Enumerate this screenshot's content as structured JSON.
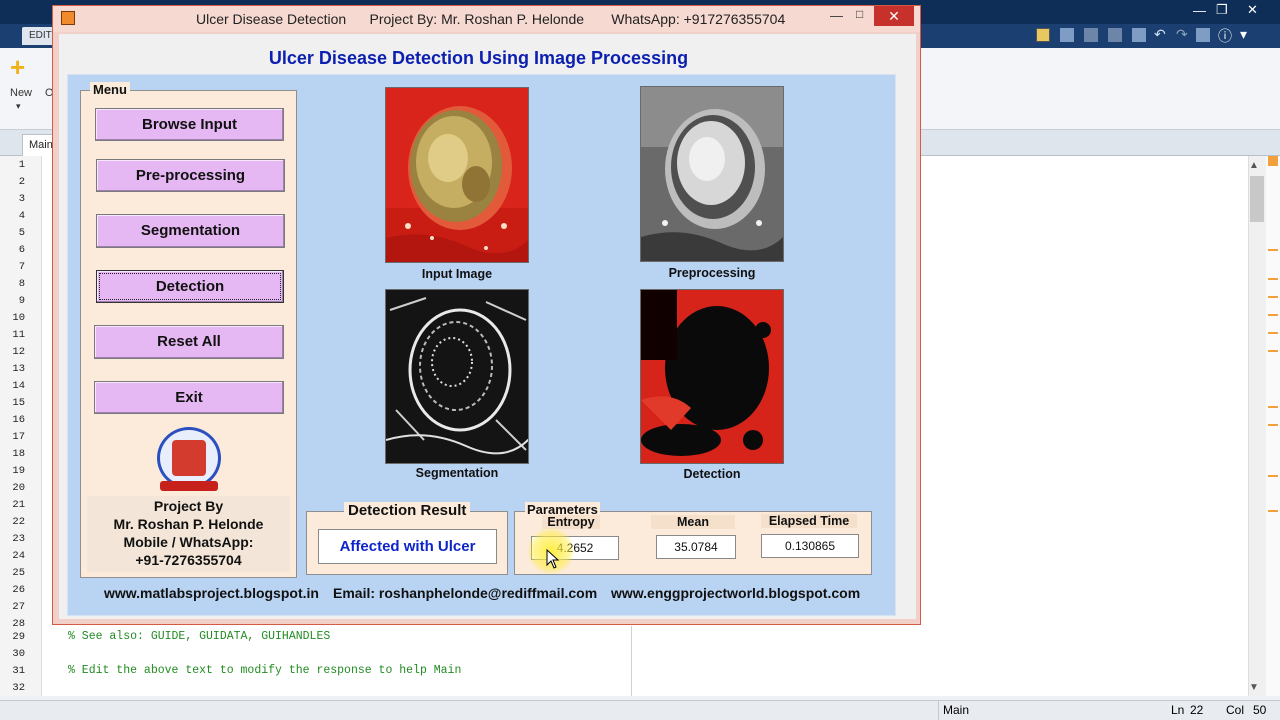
{
  "ide": {
    "editor_tab": "EDITO",
    "ribbon": {
      "new_label": "New",
      "open_label": "O"
    },
    "doc_tab": "Main",
    "line_numbers": [
      "1",
      "2",
      "3",
      "4",
      "5",
      "6",
      "7",
      "8",
      "9",
      "10",
      "11",
      "12",
      "13",
      "14",
      "15",
      "16",
      "17",
      "18",
      "19",
      "20",
      "21",
      "22",
      "23",
      "24",
      "25",
      "26",
      "27",
      "28",
      "29",
      "30",
      "31",
      "32"
    ],
    "code": {
      "line29": "% See also: GUIDE, GUIDATA, GUIHANDLES",
      "line31": "% Edit the above text to modify the response to help Main"
    },
    "status": {
      "function": "Main",
      "ln_label": "Ln",
      "ln_value": "22",
      "col_label": "Col",
      "col_value": "50"
    }
  },
  "gui": {
    "window_title": "Ulcer Disease Detection      Project By: Mr. Roshan P. Helonde       WhatsApp: +917276355704",
    "heading": "Ulcer Disease Detection Using Image Processing",
    "menu": {
      "title": "Menu",
      "buttons": [
        "Browse Input",
        "Pre-processing",
        "Segmentation",
        "Detection",
        "Reset All",
        "Exit"
      ]
    },
    "author": {
      "line1": "Project By",
      "line2": "Mr. Roshan P. Helonde",
      "line3": "Mobile / WhatsApp:",
      "line4": "+91-7276355704"
    },
    "images": {
      "input_caption": "Input Image",
      "preprocessing_caption": "Preprocessing",
      "segmentation_caption": "Segmentation",
      "detection_caption": "Detection"
    },
    "result": {
      "title": "Detection Result",
      "value": "Affected with Ulcer",
      "value_color": "#0e25c9"
    },
    "parameters": {
      "title": "Parameters",
      "entropy_label": "Entropy",
      "entropy_value": "4.2652",
      "mean_label": "Mean",
      "mean_value": "35.0784",
      "elapsed_label": "Elapsed Time",
      "elapsed_value": "0.130865"
    },
    "footer": {
      "link1": "www.matlabsproject.blogspot.in",
      "email": "Email: roshanphelonde@rediffmail.com",
      "link2": "www.enggprojectworld.blogspot.com"
    },
    "colors": {
      "panel_bg": "#b9d3f3",
      "button_bg": "#e5b7f3",
      "heading": "#0b1fb0",
      "close_button": "#c7312c"
    }
  }
}
